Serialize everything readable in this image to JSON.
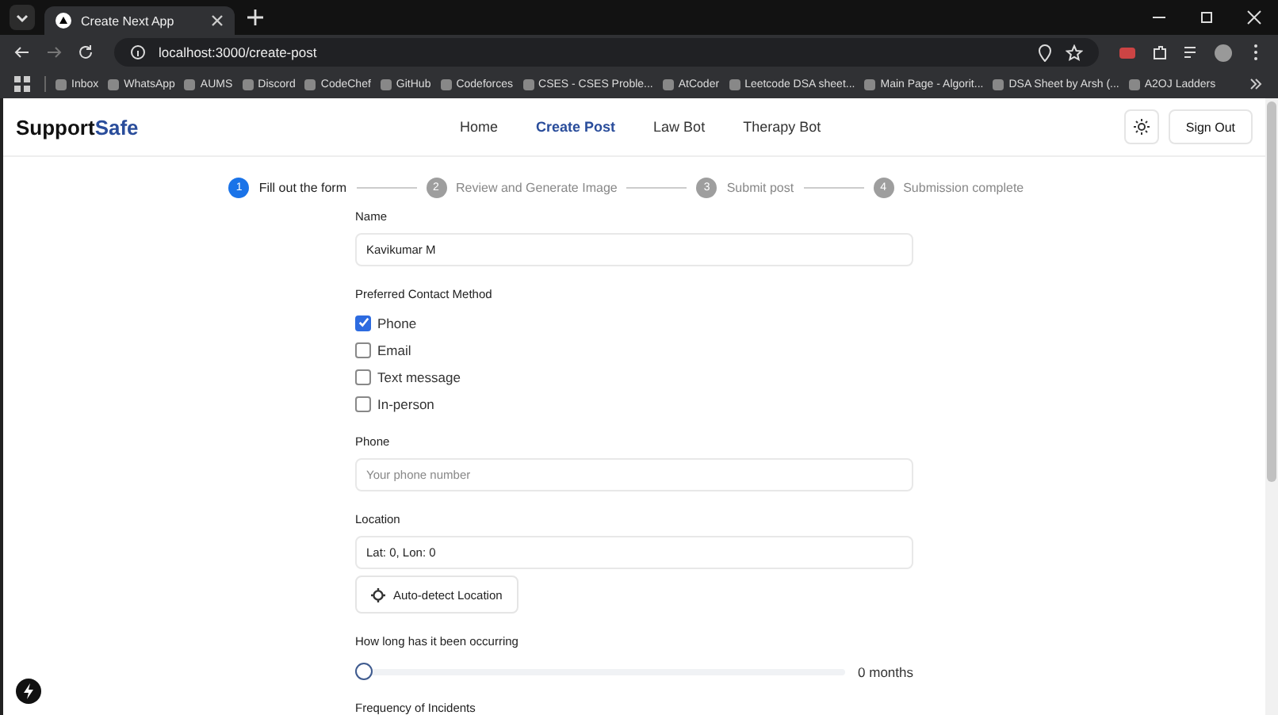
{
  "browser": {
    "tab_title": "Create Next App",
    "url": "localhost:3000/create-post",
    "bookmarks": [
      "Inbox",
      "WhatsApp",
      "AUMS",
      "Discord",
      "CodeChef",
      "GitHub",
      "Codeforces",
      "CSES - CSES Proble...",
      "AtCoder",
      "Leetcode DSA sheet...",
      "Main Page - Algorit...",
      "DSA Sheet by Arsh (...",
      "A2OJ Ladders"
    ]
  },
  "nav": {
    "brand": "Support",
    "brand_accent": "Safe",
    "links": [
      {
        "label": "Home",
        "selected": false
      },
      {
        "label": "Create Post",
        "selected": true
      },
      {
        "label": "Law Bot",
        "selected": false
      },
      {
        "label": "Therapy Bot",
        "selected": false
      }
    ],
    "sign_out": "Sign Out"
  },
  "steps": [
    {
      "number": "1",
      "label": "Fill out the form",
      "active": true
    },
    {
      "number": "2",
      "label": "Review and Generate Image",
      "active": false
    },
    {
      "number": "3",
      "label": "Submit post",
      "active": false
    },
    {
      "number": "4",
      "label": "Submission complete",
      "active": false
    }
  ],
  "form": [
    {
      "kind": "text",
      "label": "Name",
      "value": "Kavikumar M"
    },
    {
      "kind": "checkboxes",
      "label": "Preferred Contact Method",
      "options": [
        {
          "label": "Phone",
          "checked": true
        },
        {
          "label": "Email",
          "checked": false
        },
        {
          "label": "Text message",
          "checked": false
        },
        {
          "label": "In-person",
          "checked": false
        }
      ]
    },
    {
      "kind": "text",
      "label": "Phone",
      "placeholder": "Your phone number"
    },
    {
      "kind": "location",
      "label": "Location",
      "value": "Lat: 0, Lon: 0",
      "button": "Auto-detect Location"
    },
    {
      "kind": "slider",
      "label": "How long has it been occurring",
      "level": 0,
      "reading": "0 months"
    },
    {
      "kind": "heading",
      "label": "Frequency of Incidents"
    }
  ]
}
